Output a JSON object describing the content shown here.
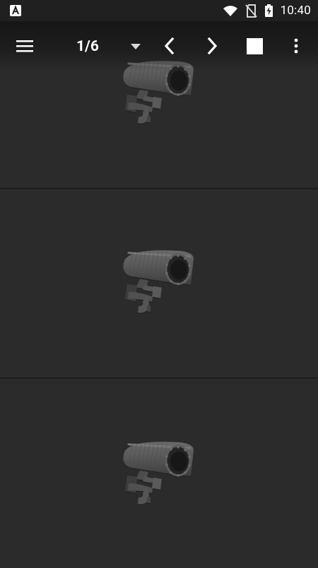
{
  "status_bar": {
    "time": "10:40",
    "icons": [
      "app-a-icon",
      "wifi-icon",
      "no-sim-icon",
      "battery-charging-icon"
    ]
  },
  "toolbar": {
    "page_indicator": "1/6",
    "icons": [
      "menu-icon",
      "dropdown-triangle-icon",
      "chevron-left-icon",
      "chevron-right-icon",
      "stop-square-icon",
      "more-vert-icon"
    ]
  },
  "cameras": [
    {
      "icon": "security-camera-icon"
    },
    {
      "icon": "security-camera-icon"
    },
    {
      "icon": "security-camera-icon"
    }
  ],
  "colors": {
    "background": "#2b2b2b",
    "statusbar": "#202020",
    "toolbar_text": "#ffffff",
    "camera_gray": "#5a5a5a"
  }
}
